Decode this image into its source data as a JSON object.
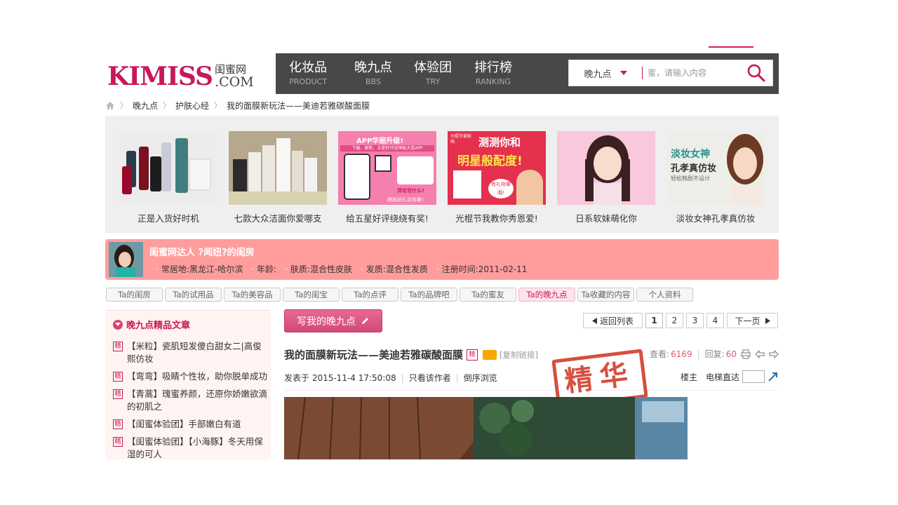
{
  "logo": {
    "brand": "KIMISS",
    "cn": "闺蜜网",
    "com": ".COM"
  },
  "nav": {
    "items": [
      {
        "cn": "化妆品",
        "en": "PRODUCT"
      },
      {
        "cn": "晚九点",
        "en": "BBS"
      },
      {
        "cn": "体验团",
        "en": "TRY"
      },
      {
        "cn": "排行榜",
        "en": "RANKING"
      }
    ],
    "search": {
      "category": "晚九点",
      "placeholder": "蜜，请输入内容",
      "button_icon": "search-icon"
    }
  },
  "breadcrumb": {
    "home_icon": "home-icon",
    "items": [
      "晚九点",
      "护肤心经",
      "我的面膜新玩法——美迪若雅碳酸面膜"
    ]
  },
  "banners": [
    {
      "caption": "正是入货好时机"
    },
    {
      "caption": "七款大众洁面你爱哪支"
    },
    {
      "caption": "给五星好评绕绕有奖!"
    },
    {
      "caption": "光棍节我教你秀恩爱!"
    },
    {
      "caption": "日系软妹萌化你"
    },
    {
      "caption": "淡妆女神孔孝真仿妆"
    }
  ],
  "banner_text": {
    "b3_a": "APP华丽升级!",
    "b3_b": "下载、更新、五星好评送神秘大奖APP",
    "b3_c": "评论写什么?",
    "b3_d": "晒妆好礼另你拿!",
    "b4_a": "光棍节爱影响",
    "b4_b": "测测你和",
    "b4_c": "明星般配度!",
    "b4_d": "有礼物拿哦!",
    "b6_a": "淡妆女神",
    "b6_b": "孔孝真仿妆",
    "b6_c": "轻松韩剧不设计"
  },
  "profile": {
    "title": "闺蜜网达人 ?闻妞?的闺房",
    "fields": [
      "常居地:黑龙江-哈尔滨",
      "年龄:",
      "肤质:混合性皮肤",
      "发质:混合性发质",
      "注册时间:2011-02-11"
    ]
  },
  "tabs": [
    {
      "label": "Ta的闺房",
      "active": false
    },
    {
      "label": "Ta的试用品",
      "active": false
    },
    {
      "label": "Ta的美容品",
      "active": false
    },
    {
      "label": "Ta的闺宝",
      "active": false
    },
    {
      "label": "Ta的点评",
      "active": false
    },
    {
      "label": "Ta的品牌吧",
      "active": false
    },
    {
      "label": "Ta的蜜友",
      "active": false
    },
    {
      "label": "Ta的晚九点",
      "active": true
    },
    {
      "label": "Ta收藏的内容",
      "active": false
    },
    {
      "label": "个人资料",
      "active": false
    }
  ],
  "sidebar": {
    "title": "晚九点精品文章",
    "badge": "精",
    "items": [
      "【米粒】瓷肌短发傻白甜女二|高俊熙仿妆",
      "【弯弯】吸睛个性妆，助你脱单成功",
      "【青蒿】瑰蜜养颜，还原你娇嫩欲滴的初肌之",
      "【闺蜜体验团】手部嫩白有道",
      "【闺蜜体验团】【小海豚】冬天用保湿的可人"
    ]
  },
  "toolbar": {
    "write_label": "写我的晚九点",
    "write_icon": "pencil-icon"
  },
  "pager": {
    "back": "返回列表",
    "pages": [
      "1",
      "2",
      "3",
      "4"
    ],
    "current": "1",
    "next": "下一页"
  },
  "post": {
    "title": "我的面膜新玩法——美迪若雅碳酸面膜",
    "badge": "精",
    "copy_link": "[复制链接]",
    "views_label": "查看:",
    "views": "6169",
    "replies_label": "回复:",
    "replies": "60",
    "posted": "发表于 2015-11-4 17:50:08",
    "author_only": "只看该作者",
    "reverse": "倒序浏览",
    "op": "楼主",
    "elevator": "电梯直达",
    "stamp": "精华"
  },
  "colors": {
    "brand": "#c8185a",
    "nav_bg": "#484848",
    "profile_bg": "#ff9d9d",
    "stat_num": "#e05a6f"
  }
}
